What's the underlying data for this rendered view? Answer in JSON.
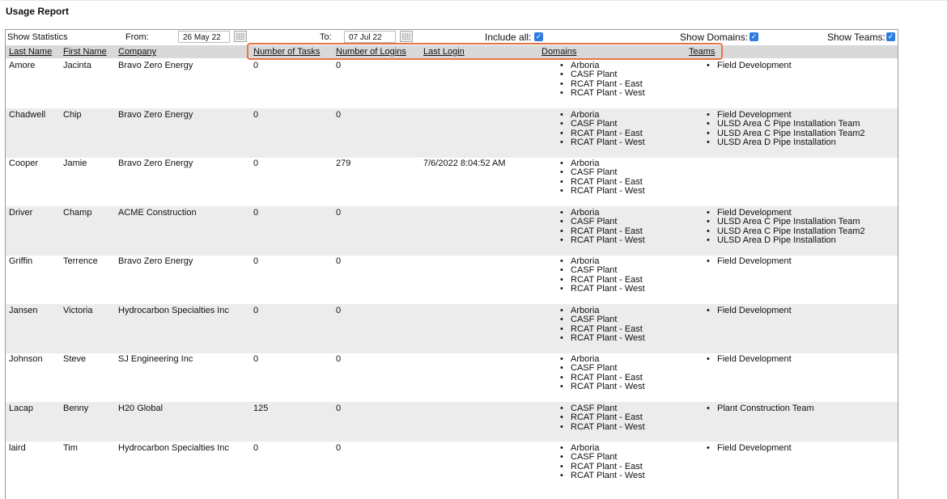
{
  "title": "Usage Report",
  "filters": {
    "show_statistics": "Show Statistics",
    "from_label": "From:",
    "from_value": "26 May 22",
    "to_label": "To:",
    "to_value": "07 Jul 22",
    "include_all": "Include all:",
    "show_domains": "Show Domains:",
    "show_teams": "Show Teams:"
  },
  "columns": [
    "Last Name",
    "First Name",
    "Company",
    "Number of Tasks",
    "Number of Logins",
    "Last Login",
    "Domains",
    "Teams"
  ],
  "rows": [
    {
      "last": "Amore",
      "first": "Jacinta",
      "company": "Bravo Zero Energy",
      "tasks": "0",
      "logins": "0",
      "last_login": "",
      "domains": [
        "Arboria",
        "CASF Plant",
        "RCAT Plant - East",
        "RCAT Plant - West"
      ],
      "teams": [
        "Field Development"
      ]
    },
    {
      "last": "Chadwell",
      "first": "Chip",
      "company": "Bravo Zero Energy",
      "tasks": "0",
      "logins": "0",
      "last_login": "",
      "domains": [
        "Arboria",
        "CASF Plant",
        "RCAT Plant - East",
        "RCAT Plant - West"
      ],
      "teams": [
        "Field Development",
        "ULSD Area C Pipe Installation Team",
        "ULSD Area C Pipe Installation Team2",
        "ULSD Area D Pipe Installation"
      ]
    },
    {
      "last": "Cooper",
      "first": "Jamie",
      "company": "Bravo Zero Energy",
      "tasks": "0",
      "logins": "279",
      "last_login": "7/6/2022 8:04:52 AM",
      "domains": [
        "Arboria",
        "CASF Plant",
        "RCAT Plant - East",
        "RCAT Plant - West"
      ],
      "teams": []
    },
    {
      "last": "Driver",
      "first": "Champ",
      "company": "ACME Construction",
      "tasks": "0",
      "logins": "0",
      "last_login": "",
      "domains": [
        "Arboria",
        "CASF Plant",
        "RCAT Plant - East",
        "RCAT Plant - West"
      ],
      "teams": [
        "Field Development",
        "ULSD Area C Pipe Installation Team",
        "ULSD Area C Pipe Installation Team2",
        "ULSD Area D Pipe Installation"
      ]
    },
    {
      "last": "Griffin",
      "first": "Terrence",
      "company": "Bravo Zero Energy",
      "tasks": "0",
      "logins": "0",
      "last_login": "",
      "domains": [
        "Arboria",
        "CASF Plant",
        "RCAT Plant - East",
        "RCAT Plant - West"
      ],
      "teams": [
        "Field Development"
      ]
    },
    {
      "last": "Jansen",
      "first": "Victoria",
      "company": "Hydrocarbon Specialties Inc",
      "tasks": "0",
      "logins": "0",
      "last_login": "",
      "domains": [
        "Arboria",
        "CASF Plant",
        "RCAT Plant - East",
        "RCAT Plant - West"
      ],
      "teams": [
        "Field Development"
      ]
    },
    {
      "last": "Johnson",
      "first": "Steve",
      "company": "SJ Engineering Inc",
      "tasks": "0",
      "logins": "0",
      "last_login": "",
      "domains": [
        "Arboria",
        "CASF Plant",
        "RCAT Plant - East",
        "RCAT Plant - West"
      ],
      "teams": [
        "Field Development"
      ]
    },
    {
      "last": "Lacap",
      "first": "Benny",
      "company": "H20 Global",
      "tasks": "125",
      "logins": "0",
      "last_login": "",
      "domains": [
        "CASF Plant",
        "RCAT Plant - East",
        "RCAT Plant - West"
      ],
      "teams": [
        "Plant Construction Team"
      ]
    },
    {
      "last": "laird",
      "first": "Tim",
      "company": "Hydrocarbon Specialties Inc",
      "tasks": "0",
      "logins": "0",
      "last_login": "",
      "domains": [
        "Arboria",
        "CASF Plant",
        "RCAT Plant - East",
        "RCAT Plant - West"
      ],
      "teams": [
        "Field Development"
      ]
    }
  ]
}
